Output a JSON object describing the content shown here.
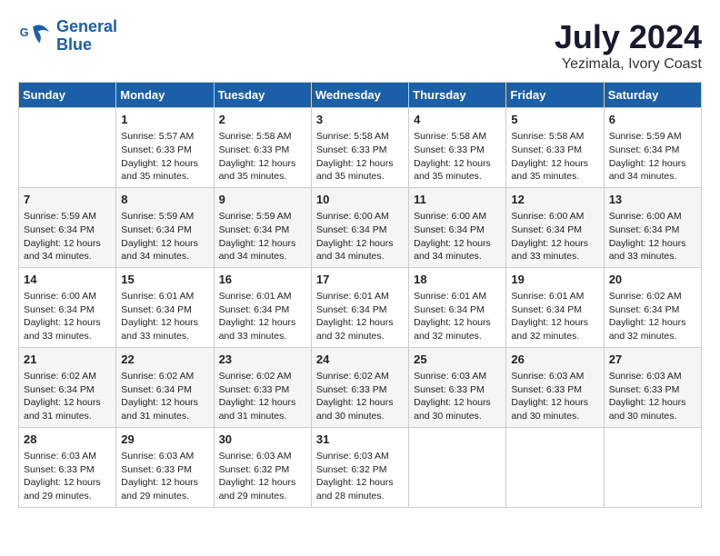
{
  "header": {
    "logo_line1": "General",
    "logo_line2": "Blue",
    "month": "July 2024",
    "location": "Yezimala, Ivory Coast"
  },
  "days_of_week": [
    "Sunday",
    "Monday",
    "Tuesday",
    "Wednesday",
    "Thursday",
    "Friday",
    "Saturday"
  ],
  "weeks": [
    [
      {
        "day": "",
        "sunrise": "",
        "sunset": "",
        "daylight": ""
      },
      {
        "day": "1",
        "sunrise": "Sunrise: 5:57 AM",
        "sunset": "Sunset: 6:33 PM",
        "daylight": "Daylight: 12 hours and 35 minutes."
      },
      {
        "day": "2",
        "sunrise": "Sunrise: 5:58 AM",
        "sunset": "Sunset: 6:33 PM",
        "daylight": "Daylight: 12 hours and 35 minutes."
      },
      {
        "day": "3",
        "sunrise": "Sunrise: 5:58 AM",
        "sunset": "Sunset: 6:33 PM",
        "daylight": "Daylight: 12 hours and 35 minutes."
      },
      {
        "day": "4",
        "sunrise": "Sunrise: 5:58 AM",
        "sunset": "Sunset: 6:33 PM",
        "daylight": "Daylight: 12 hours and 35 minutes."
      },
      {
        "day": "5",
        "sunrise": "Sunrise: 5:58 AM",
        "sunset": "Sunset: 6:33 PM",
        "daylight": "Daylight: 12 hours and 35 minutes."
      },
      {
        "day": "6",
        "sunrise": "Sunrise: 5:59 AM",
        "sunset": "Sunset: 6:34 PM",
        "daylight": "Daylight: 12 hours and 34 minutes."
      }
    ],
    [
      {
        "day": "7",
        "sunrise": "Sunrise: 5:59 AM",
        "sunset": "Sunset: 6:34 PM",
        "daylight": "Daylight: 12 hours and 34 minutes."
      },
      {
        "day": "8",
        "sunrise": "Sunrise: 5:59 AM",
        "sunset": "Sunset: 6:34 PM",
        "daylight": "Daylight: 12 hours and 34 minutes."
      },
      {
        "day": "9",
        "sunrise": "Sunrise: 5:59 AM",
        "sunset": "Sunset: 6:34 PM",
        "daylight": "Daylight: 12 hours and 34 minutes."
      },
      {
        "day": "10",
        "sunrise": "Sunrise: 6:00 AM",
        "sunset": "Sunset: 6:34 PM",
        "daylight": "Daylight: 12 hours and 34 minutes."
      },
      {
        "day": "11",
        "sunrise": "Sunrise: 6:00 AM",
        "sunset": "Sunset: 6:34 PM",
        "daylight": "Daylight: 12 hours and 34 minutes."
      },
      {
        "day": "12",
        "sunrise": "Sunrise: 6:00 AM",
        "sunset": "Sunset: 6:34 PM",
        "daylight": "Daylight: 12 hours and 33 minutes."
      },
      {
        "day": "13",
        "sunrise": "Sunrise: 6:00 AM",
        "sunset": "Sunset: 6:34 PM",
        "daylight": "Daylight: 12 hours and 33 minutes."
      }
    ],
    [
      {
        "day": "14",
        "sunrise": "Sunrise: 6:00 AM",
        "sunset": "Sunset: 6:34 PM",
        "daylight": "Daylight: 12 hours and 33 minutes."
      },
      {
        "day": "15",
        "sunrise": "Sunrise: 6:01 AM",
        "sunset": "Sunset: 6:34 PM",
        "daylight": "Daylight: 12 hours and 33 minutes."
      },
      {
        "day": "16",
        "sunrise": "Sunrise: 6:01 AM",
        "sunset": "Sunset: 6:34 PM",
        "daylight": "Daylight: 12 hours and 33 minutes."
      },
      {
        "day": "17",
        "sunrise": "Sunrise: 6:01 AM",
        "sunset": "Sunset: 6:34 PM",
        "daylight": "Daylight: 12 hours and 32 minutes."
      },
      {
        "day": "18",
        "sunrise": "Sunrise: 6:01 AM",
        "sunset": "Sunset: 6:34 PM",
        "daylight": "Daylight: 12 hours and 32 minutes."
      },
      {
        "day": "19",
        "sunrise": "Sunrise: 6:01 AM",
        "sunset": "Sunset: 6:34 PM",
        "daylight": "Daylight: 12 hours and 32 minutes."
      },
      {
        "day": "20",
        "sunrise": "Sunrise: 6:02 AM",
        "sunset": "Sunset: 6:34 PM",
        "daylight": "Daylight: 12 hours and 32 minutes."
      }
    ],
    [
      {
        "day": "21",
        "sunrise": "Sunrise: 6:02 AM",
        "sunset": "Sunset: 6:34 PM",
        "daylight": "Daylight: 12 hours and 31 minutes."
      },
      {
        "day": "22",
        "sunrise": "Sunrise: 6:02 AM",
        "sunset": "Sunset: 6:34 PM",
        "daylight": "Daylight: 12 hours and 31 minutes."
      },
      {
        "day": "23",
        "sunrise": "Sunrise: 6:02 AM",
        "sunset": "Sunset: 6:33 PM",
        "daylight": "Daylight: 12 hours and 31 minutes."
      },
      {
        "day": "24",
        "sunrise": "Sunrise: 6:02 AM",
        "sunset": "Sunset: 6:33 PM",
        "daylight": "Daylight: 12 hours and 30 minutes."
      },
      {
        "day": "25",
        "sunrise": "Sunrise: 6:03 AM",
        "sunset": "Sunset: 6:33 PM",
        "daylight": "Daylight: 12 hours and 30 minutes."
      },
      {
        "day": "26",
        "sunrise": "Sunrise: 6:03 AM",
        "sunset": "Sunset: 6:33 PM",
        "daylight": "Daylight: 12 hours and 30 minutes."
      },
      {
        "day": "27",
        "sunrise": "Sunrise: 6:03 AM",
        "sunset": "Sunset: 6:33 PM",
        "daylight": "Daylight: 12 hours and 30 minutes."
      }
    ],
    [
      {
        "day": "28",
        "sunrise": "Sunrise: 6:03 AM",
        "sunset": "Sunset: 6:33 PM",
        "daylight": "Daylight: 12 hours and 29 minutes."
      },
      {
        "day": "29",
        "sunrise": "Sunrise: 6:03 AM",
        "sunset": "Sunset: 6:33 PM",
        "daylight": "Daylight: 12 hours and 29 minutes."
      },
      {
        "day": "30",
        "sunrise": "Sunrise: 6:03 AM",
        "sunset": "Sunset: 6:32 PM",
        "daylight": "Daylight: 12 hours and 29 minutes."
      },
      {
        "day": "31",
        "sunrise": "Sunrise: 6:03 AM",
        "sunset": "Sunset: 6:32 PM",
        "daylight": "Daylight: 12 hours and 28 minutes."
      },
      {
        "day": "",
        "sunrise": "",
        "sunset": "",
        "daylight": ""
      },
      {
        "day": "",
        "sunrise": "",
        "sunset": "",
        "daylight": ""
      },
      {
        "day": "",
        "sunrise": "",
        "sunset": "",
        "daylight": ""
      }
    ]
  ]
}
